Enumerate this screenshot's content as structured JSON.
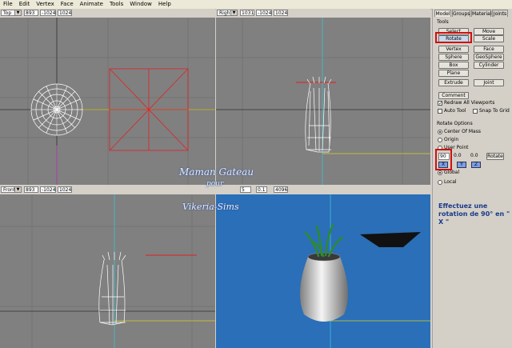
{
  "menu": [
    "File",
    "Edit",
    "Vertex",
    "Face",
    "Animate",
    "Tools",
    "Window",
    "Help"
  ],
  "viewports": {
    "top": {
      "view": "Top",
      "f1": "893",
      "f2": "-1024",
      "f3": "1024"
    },
    "right": {
      "view": "Right",
      "f1": "1031",
      "f2": "-1024",
      "f3": "1024"
    },
    "front": {
      "view": "Front",
      "f1": "893",
      "f2": "-1024",
      "f3": "1024"
    },
    "persp": {
      "f1": "5",
      "f2": "0.1",
      "f3": "4096"
    }
  },
  "panel": {
    "tabs": [
      "Model",
      "Groups",
      "Materials",
      "Joints"
    ],
    "tools_label": "Tools",
    "buttons": [
      "Select",
      "Move",
      "Rotate",
      "Scale",
      "Vertex",
      "Face",
      "Sphere",
      "GeoSphere",
      "Box",
      "Cylinder",
      "Plane",
      "Extrude",
      "Joint"
    ],
    "comment": "Comment",
    "redraw": "Redraw All Viewports",
    "auto_tool": "Auto Tool",
    "snap_grid": "Snap To Grid",
    "rotate_options": "Rotate Options",
    "center_mass": "Center Of Mass",
    "origin": "Origin",
    "user_point": "User Point",
    "rot_x": "90",
    "rot_y": "0.0",
    "rot_z": "0.0",
    "rotate_btn": "Rotate",
    "axis_x": "X",
    "axis_y": "Y",
    "axis_z": "Z",
    "global": "Global",
    "local": "Local"
  },
  "note": "Effectuez une rotation de 90° en \" X \"",
  "watermark": {
    "line1": "Maman Gateau",
    "line2": "pour",
    "line3": "Vikeria-Sims"
  },
  "colors": {
    "bg_blue": "#2a6fb8",
    "red": "#e02020",
    "yellow": "#d8d020",
    "cyan": "#40c0d8",
    "magenta": "#c040c0"
  }
}
